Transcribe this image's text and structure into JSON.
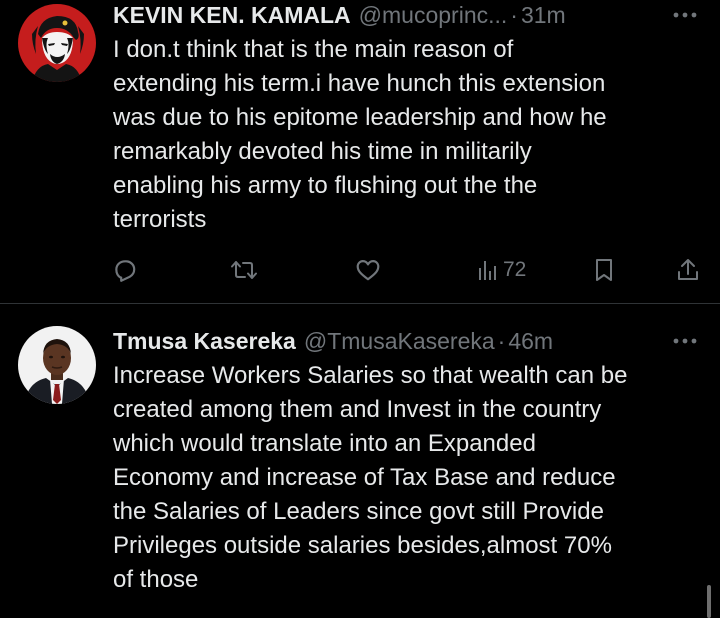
{
  "tweets": [
    {
      "name": "KEVIN KEN. KAMALA",
      "handle": "@mucoprinc...",
      "separator": "·",
      "time": "31m",
      "text": "I don.t think that is the main reason of\nextending his term.i have hunch this extension\nwas due to his epitome leadership and how he\nremarkably devoted his time in militarily\nenabling his army to flushing out the the\nterrorists",
      "views": "72",
      "avatar_colors": {
        "background": "#c51d1d",
        "portrait": "#141414"
      }
    },
    {
      "name": "Tmusa Kasereka",
      "handle": "@TmusaKasereka",
      "separator": "·",
      "time": "46m",
      "text": "Increase Workers Salaries so that wealth can be\ncreated among them and Invest in the country\nwhich would translate into an Expanded\nEconomy and increase of Tax Base and reduce\nthe Salaries of Leaders since govt still Provide\nPrivileges outside salaries besides,almost 70%\nof those",
      "avatar_colors": {
        "background": "#f2f2f2",
        "suit": "#1a1d24",
        "tie": "#8b1c1c"
      }
    }
  ],
  "icons": {
    "more": "more-icon",
    "reply": "reply-icon",
    "retweet": "retweet-icon",
    "like": "like-icon",
    "views": "views-icon",
    "bookmark": "bookmark-icon",
    "share": "share-icon"
  },
  "colors": {
    "background": "#000000",
    "text_primary": "#e7e9ea",
    "text_secondary": "#71767b",
    "divider": "#2f3336"
  }
}
